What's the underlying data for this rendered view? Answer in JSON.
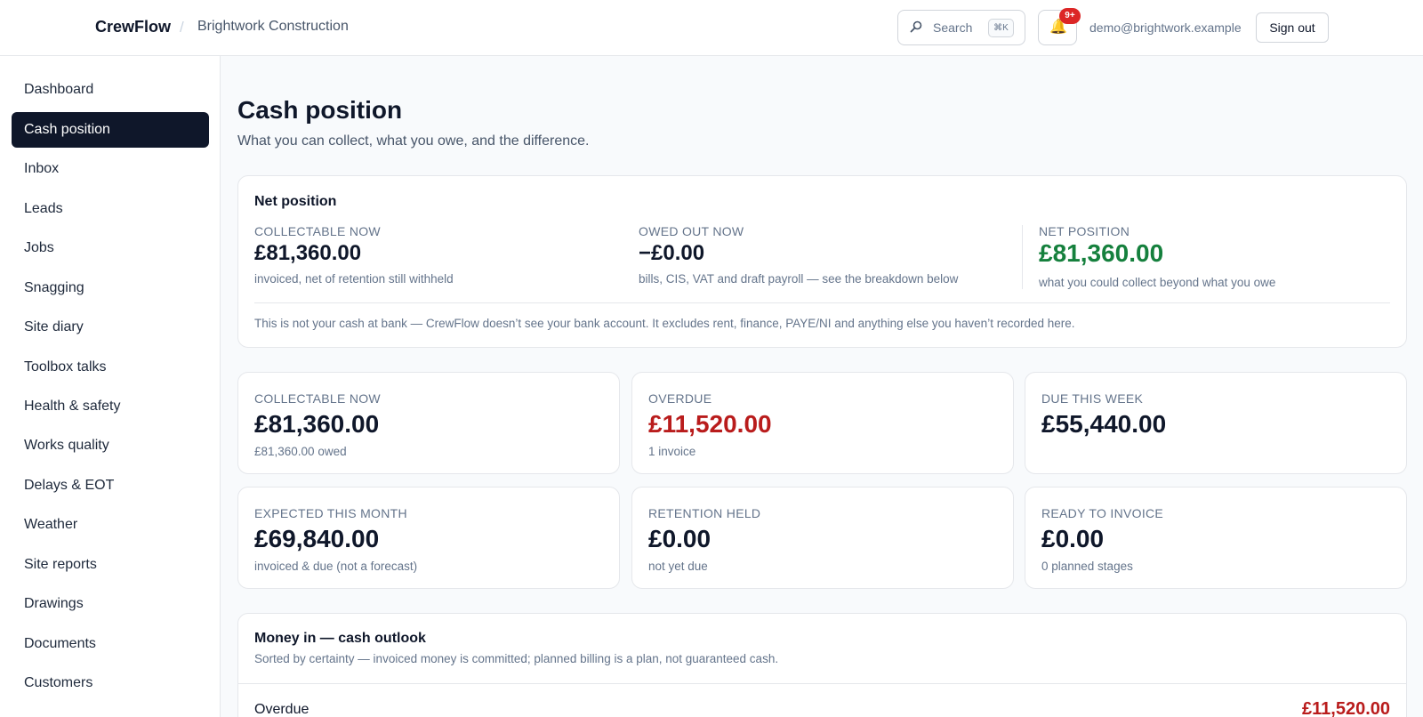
{
  "header": {
    "brand": "CrewFlow",
    "separator": "/",
    "org": "Brightwork Construction",
    "search_label": "Search",
    "search_shortcut": "⌘K",
    "notification_badge": "9+",
    "user_email": "demo@brightwork.example",
    "sign_out": "Sign out"
  },
  "sidebar": {
    "items": [
      {
        "label": "Dashboard"
      },
      {
        "label": "Cash position",
        "active": true
      },
      {
        "label": "Inbox"
      },
      {
        "label": "Leads"
      },
      {
        "label": "Jobs"
      },
      {
        "label": "Snagging"
      },
      {
        "label": "Site diary"
      },
      {
        "label": "Toolbox talks"
      },
      {
        "label": "Health & safety"
      },
      {
        "label": "Works quality"
      },
      {
        "label": "Delays & EOT"
      },
      {
        "label": "Weather"
      },
      {
        "label": "Site reports"
      },
      {
        "label": "Drawings"
      },
      {
        "label": "Documents"
      },
      {
        "label": "Customers"
      }
    ]
  },
  "page": {
    "title": "Cash position",
    "subtitle": "What you can collect, what you owe, and the difference."
  },
  "net_position": {
    "heading": "Net position",
    "collectable": {
      "label": "COLLECTABLE NOW",
      "value": "£81,360.00",
      "note": "invoiced, net of retention still withheld"
    },
    "owed": {
      "label": "OWED OUT NOW",
      "value": "−£0.00",
      "note": "bills, CIS, VAT and draft payroll — see the breakdown below"
    },
    "net": {
      "label": "NET POSITION",
      "value": "£81,360.00",
      "note": "what you could collect beyond what you owe"
    },
    "disclaimer": "This is not your cash at bank — CrewFlow doesn’t see your bank account. It excludes rent, finance, PAYE/NI and anything else you haven’t recorded here."
  },
  "stats": [
    {
      "label": "COLLECTABLE NOW",
      "value": "£81,360.00",
      "sub": "£81,360.00 owed",
      "tone": "normal"
    },
    {
      "label": "OVERDUE",
      "value": "£11,520.00",
      "sub": "1 invoice",
      "tone": "red"
    },
    {
      "label": "DUE THIS WEEK",
      "value": "£55,440.00",
      "sub": "",
      "tone": "normal"
    },
    {
      "label": "EXPECTED THIS MONTH",
      "value": "£69,840.00",
      "sub": "invoiced & due (not a forecast)",
      "tone": "normal"
    },
    {
      "label": "RETENTION HELD",
      "value": "£0.00",
      "sub": "not yet due",
      "tone": "normal"
    },
    {
      "label": "READY TO INVOICE",
      "value": "£0.00",
      "sub": "0 planned stages",
      "tone": "normal"
    }
  ],
  "outlook": {
    "heading": "Money in — cash outlook",
    "subtitle": "Sorted by certainty — invoiced money is committed; planned billing is a plan, not guaranteed cash.",
    "rows": [
      {
        "label": "Overdue",
        "amount": "£11,520.00"
      }
    ]
  },
  "colors": {
    "accent_dark": "#0f172a",
    "positive": "#15803d",
    "negative": "#b91c1c",
    "badge": "#dc2626"
  },
  "icons": {
    "search": "search-icon",
    "bell": "bell-icon"
  }
}
